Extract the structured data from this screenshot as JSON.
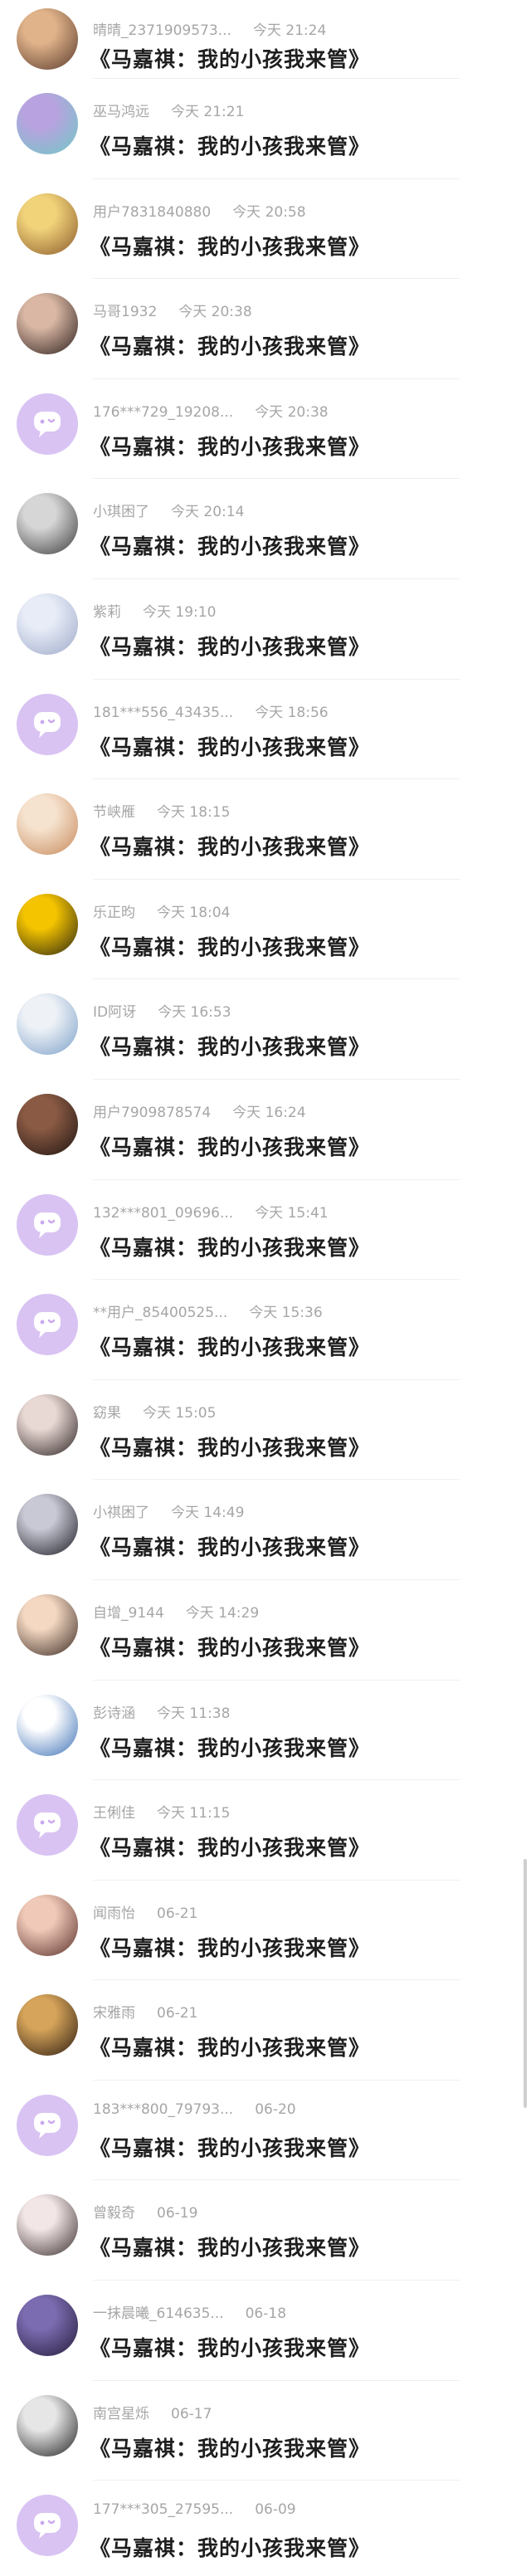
{
  "comments": [
    {
      "username": "晴晴_2371909573...",
      "time": "今天 21:24",
      "title": "《马嘉祺：我的小孩我来管》",
      "avatar": {
        "icon": "photo-avatar",
        "type": "photo",
        "colors": [
          "#e0b38a",
          "#5b3b2c"
        ]
      }
    },
    {
      "username": "巫马鸿远",
      "time": "今天 21:21",
      "title": "《马嘉祺：我的小孩我来管》",
      "avatar": {
        "icon": "photo-avatar",
        "type": "photo",
        "colors": [
          "#b9a2e0",
          "#6fc9c4"
        ]
      }
    },
    {
      "username": "用户7831840880",
      "time": "今天 20:58",
      "title": "《马嘉祺：我的小孩我来管》",
      "avatar": {
        "icon": "photo-avatar",
        "type": "photo",
        "colors": [
          "#f1d37a",
          "#8b5a2b"
        ]
      }
    },
    {
      "username": "马哥1932",
      "time": "今天 20:38",
      "title": "《马嘉祺：我的小孩我来管》",
      "avatar": {
        "icon": "photo-avatar",
        "type": "photo",
        "colors": [
          "#d9b7a4",
          "#2d1f1c"
        ]
      }
    },
    {
      "username": "176***729_19208...",
      "time": "今天 20:38",
      "title": "《马嘉祺：我的小孩我来管》",
      "avatar": {
        "icon": "default-chat-avatar-icon",
        "type": "default"
      }
    },
    {
      "username": "小琪困了",
      "time": "今天 20:14",
      "title": "《马嘉祺：我的小孩我来管》",
      "avatar": {
        "icon": "photo-avatar",
        "type": "photo",
        "colors": [
          "#d6d6d6",
          "#3c3c3c"
        ]
      }
    },
    {
      "username": "紫莉",
      "time": "今天 19:10",
      "title": "《马嘉祺：我的小孩我来管》",
      "avatar": {
        "icon": "photo-avatar",
        "type": "photo",
        "colors": [
          "#e7ecf7",
          "#9ea9c9"
        ]
      }
    },
    {
      "username": "181***556_43435...",
      "time": "今天 18:56",
      "title": "《马嘉祺：我的小孩我来管》",
      "avatar": {
        "icon": "default-chat-avatar-icon",
        "type": "default"
      }
    },
    {
      "username": "节峡雁",
      "time": "今天 18:15",
      "title": "《马嘉祺：我的小孩我来管》",
      "avatar": {
        "icon": "photo-avatar",
        "type": "photo",
        "colors": [
          "#f6e3cf",
          "#c78a5c"
        ]
      }
    },
    {
      "username": "乐正昀",
      "time": "今天 18:04",
      "title": "《马嘉祺：我的小孩我来管》",
      "avatar": {
        "icon": "photo-avatar",
        "type": "photo",
        "colors": [
          "#f5c400",
          "#2a2510"
        ]
      }
    },
    {
      "username": "ID阿讶",
      "time": "今天 16:53",
      "title": "《马嘉祺：我的小孩我来管》",
      "avatar": {
        "icon": "photo-avatar",
        "type": "photo",
        "colors": [
          "#eef2f7",
          "#7da0c8"
        ]
      }
    },
    {
      "username": "用户7909878574",
      "time": "今天 16:24",
      "title": "《马嘉祺：我的小孩我来管》",
      "avatar": {
        "icon": "photo-avatar",
        "type": "photo",
        "colors": [
          "#8a5a44",
          "#1f1410"
        ]
      }
    },
    {
      "username": "132***801_09696...",
      "time": "今天 15:41",
      "title": "《马嘉祺：我的小孩我来管》",
      "avatar": {
        "icon": "default-chat-avatar-icon",
        "type": "default"
      }
    },
    {
      "username": "**用户_85400525...",
      "time": "今天 15:36",
      "title": "《马嘉祺：我的小孩我来管》",
      "avatar": {
        "icon": "default-chat-avatar-icon",
        "type": "default"
      }
    },
    {
      "username": "窈果",
      "time": "今天 15:05",
      "title": "《马嘉祺：我的小孩我来管》",
      "avatar": {
        "icon": "photo-avatar",
        "type": "photo",
        "colors": [
          "#e9d9d4",
          "#2b2222"
        ]
      }
    },
    {
      "username": "小祺困了",
      "time": "今天 14:49",
      "title": "《马嘉祺：我的小孩我来管》",
      "avatar": {
        "icon": "photo-avatar",
        "type": "photo",
        "colors": [
          "#c9c9d6",
          "#1b1b22"
        ]
      }
    },
    {
      "username": "自增_9144",
      "time": "今天 14:29",
      "title": "《马嘉祺：我的小孩我来管》",
      "avatar": {
        "icon": "photo-avatar",
        "type": "photo",
        "colors": [
          "#f4d8c2",
          "#3a2a22"
        ]
      }
    },
    {
      "username": "彭诗涵",
      "time": "今天 11:38",
      "title": "《马嘉祺：我的小孩我来管》",
      "avatar": {
        "icon": "photo-avatar",
        "type": "photo",
        "colors": [
          "#ffffff",
          "#3b6fb6"
        ]
      }
    },
    {
      "username": "王俐佳",
      "time": "今天 11:15",
      "title": "《马嘉祺：我的小孩我来管》",
      "avatar": {
        "icon": "default-chat-avatar-icon",
        "type": "default"
      }
    },
    {
      "username": "闻雨怡",
      "time": "06-21",
      "title": "《马嘉祺：我的小孩我来管》",
      "avatar": {
        "icon": "photo-avatar",
        "type": "photo",
        "colors": [
          "#f0c9b8",
          "#5a2f2a"
        ]
      }
    },
    {
      "username": "宋雅雨",
      "time": "06-21",
      "title": "《马嘉祺：我的小孩我来管》",
      "avatar": {
        "icon": "photo-avatar",
        "type": "photo",
        "colors": [
          "#d6a45a",
          "#2c1c10"
        ]
      }
    },
    {
      "username": "183***800_79793...",
      "time": "06-20",
      "title": "《马嘉祺：我的小孩我来管》",
      "avatar": {
        "icon": "default-chat-avatar-icon",
        "type": "default"
      }
    },
    {
      "username": "曾毅奇",
      "time": "06-19",
      "title": "《马嘉祺：我的小孩我来管》",
      "avatar": {
        "icon": "photo-avatar",
        "type": "photo",
        "colors": [
          "#f3e6e6",
          "#3a2e2e"
        ]
      }
    },
    {
      "username": "一抹晨曦_614635...",
      "time": "06-18",
      "title": "《马嘉祺：我的小孩我来管》",
      "avatar": {
        "icon": "photo-avatar",
        "type": "photo",
        "colors": [
          "#7b6bb0",
          "#241c3a"
        ]
      }
    },
    {
      "username": "南宫星烁",
      "time": "06-17",
      "title": "《马嘉祺：我的小孩我来管》",
      "avatar": {
        "icon": "photo-avatar",
        "type": "photo",
        "colors": [
          "#e6e6e6",
          "#202020"
        ]
      }
    },
    {
      "username": "177***305_27595...",
      "time": "06-09",
      "title": "《马嘉祺：我的小孩我来管》",
      "avatar": {
        "icon": "default-chat-avatar-icon",
        "type": "default"
      }
    }
  ]
}
